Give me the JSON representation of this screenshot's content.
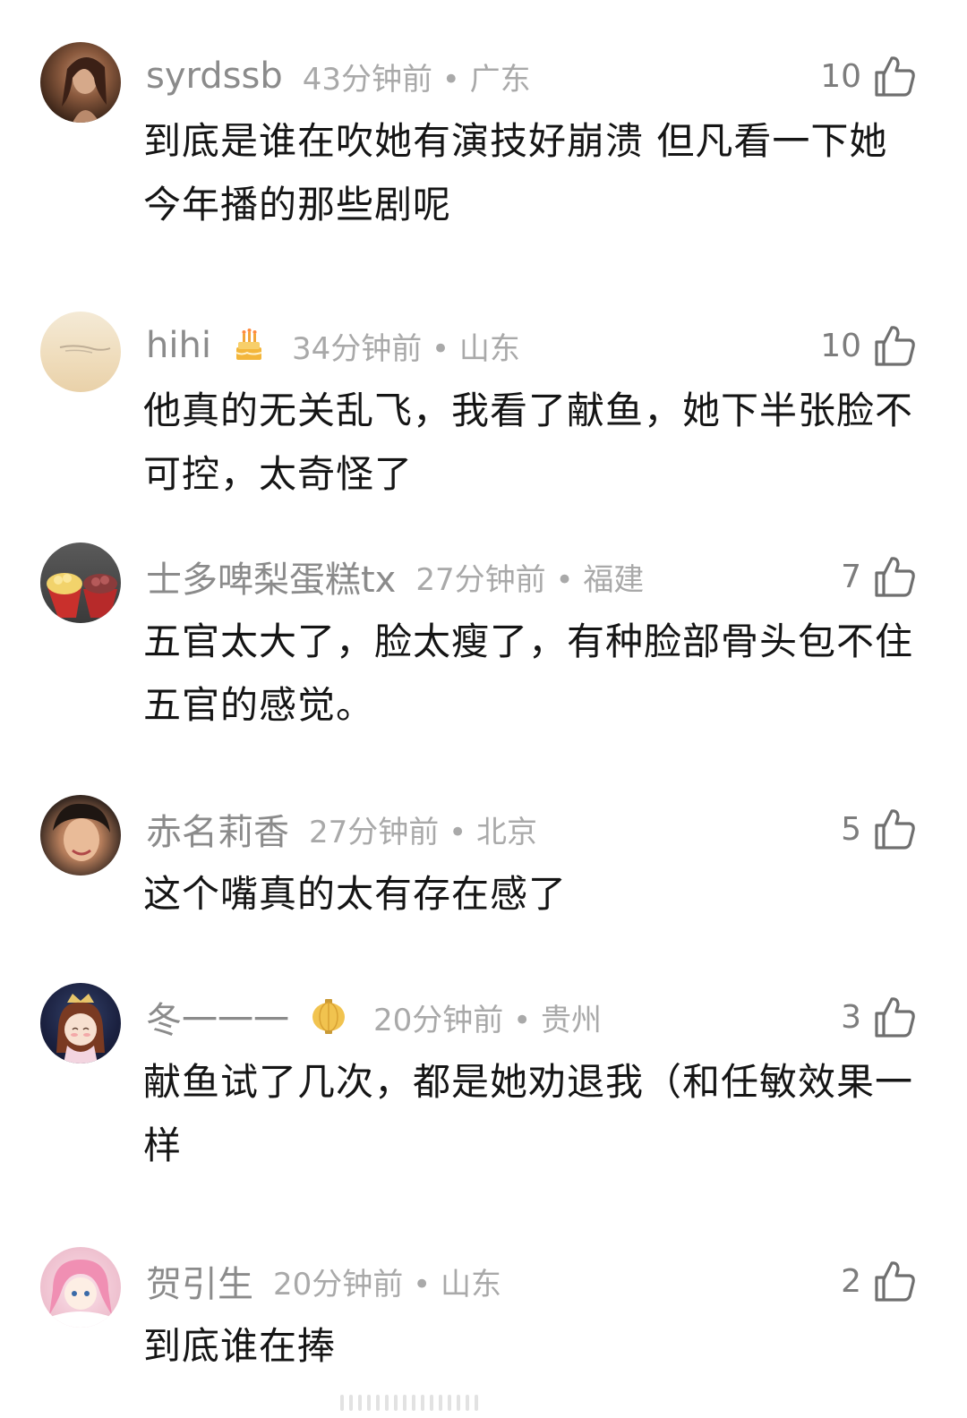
{
  "comments": [
    {
      "username": "syrdssb",
      "time": "43分钟前",
      "location": "广东",
      "likes": "10",
      "text": "到底是谁在吹她有演技好崩溃 但凡看一下她今年播的那些剧呢",
      "badge_icon": ""
    },
    {
      "username": "hihi",
      "time": "34分钟前",
      "location": "山东",
      "likes": "10",
      "text": "他真的无关乱飞，我看了献鱼，她下半张脸不可控，太奇怪了",
      "badge_icon": "birthday-cake-icon"
    },
    {
      "username": "士多啤梨蛋糕tx",
      "time": "27分钟前",
      "location": "福建",
      "likes": "7",
      "text": "五官太大了，脸太瘦了，有种脸部骨头包不住五官的感觉。",
      "badge_icon": ""
    },
    {
      "username": "赤名莉香",
      "time": "27分钟前",
      "location": "北京",
      "likes": "5",
      "text": "这个嘴真的太有存在感了",
      "badge_icon": ""
    },
    {
      "username": "冬一一一",
      "time": "20分钟前",
      "location": "贵州",
      "likes": "3",
      "text": "献鱼试了几次，都是她劝退我（和任敏效果一样",
      "badge_icon": "lantern-icon"
    },
    {
      "username": "贺引生",
      "time": "20分钟前",
      "location": "山东",
      "likes": "2",
      "text": "到底谁在捧",
      "badge_icon": ""
    }
  ],
  "separator": "•",
  "colors": {
    "username": "#8b8b8b",
    "meta": "#a9a9a9",
    "text": "#151515",
    "like_icon": "#6f6f6f"
  }
}
